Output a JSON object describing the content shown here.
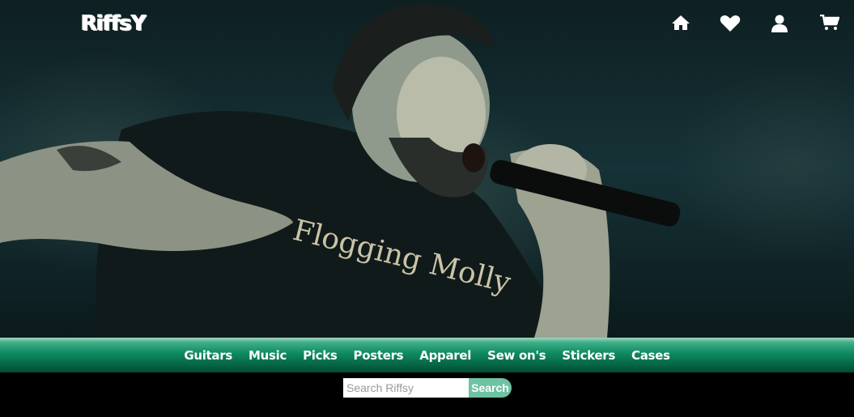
{
  "header": {
    "logo_text": "RiffsY",
    "icons": [
      "home-icon",
      "heart-icon",
      "user-icon",
      "cart-icon"
    ]
  },
  "hero": {
    "shirt_text": "Flogging Molly"
  },
  "menu": {
    "items": [
      "Guitars",
      "Music",
      "Picks",
      "Posters",
      "Apparel",
      "Sew on's",
      "Stickers",
      "Cases"
    ]
  },
  "search": {
    "placeholder": "Search Riffsy",
    "button_label": "Search"
  },
  "colors": {
    "menu_green": "#0e8a62",
    "search_button": "#6fc3a2"
  }
}
